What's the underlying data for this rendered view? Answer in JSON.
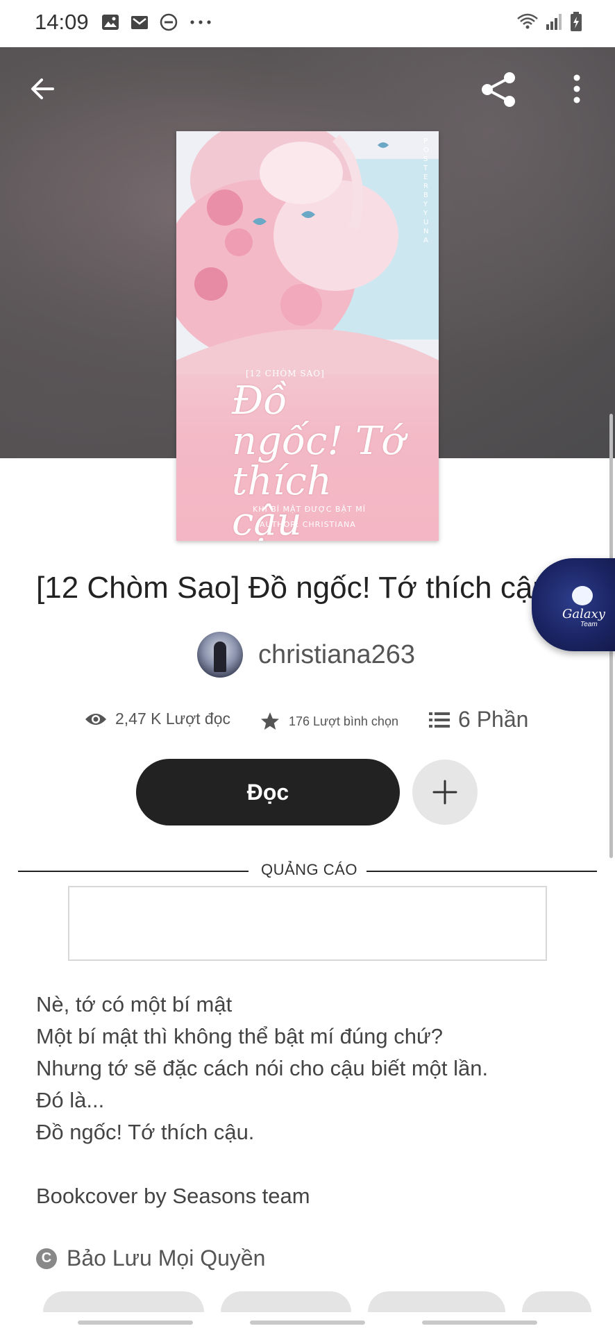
{
  "status_bar": {
    "time": "14:09",
    "icons_left": [
      "image-icon",
      "mail-icon",
      "do-not-disturb-icon",
      "more-dots-icon"
    ],
    "icons_right": [
      "wifi-icon",
      "signal-icon",
      "battery-charging-icon"
    ]
  },
  "header": {
    "back_icon": "arrow-left-icon",
    "share_icon": "share-icon",
    "more_icon": "more-vertical-icon"
  },
  "cover": {
    "series": "[12 CHÒM SAO]",
    "title": "Đồ ngốc! Tớ thích cậu",
    "subtitle": "KHI BÍ MẬT ĐƯỢC BẬT MÍ",
    "author": "AUTHOR: CHRISTIANA",
    "poster": "POSTER BY YUNA"
  },
  "story": {
    "title": "[12 Chòm Sao] Đồ ngốc! Tớ thích cậu"
  },
  "galaxy_bubble": {
    "label": "Galaxy",
    "sub": "Team"
  },
  "author": {
    "name": "christiana263"
  },
  "stats": {
    "reads": "2,47 K Lượt đọc",
    "votes": "176 Lượt bình chọn",
    "parts": "6 Phần"
  },
  "actions": {
    "read_label": "Đọc",
    "add_icon": "plus-icon"
  },
  "ad": {
    "label": "QUẢNG CÁO"
  },
  "description": {
    "lines": [
      "Nè, tớ có một bí mật",
      "Một bí mật thì không thể bật mí đúng chứ?",
      "Nhưng tớ sẽ đặc cách nói cho cậu biết một lần.",
      "Đó là...",
      "Đồ ngốc! Tớ thích cậu."
    ],
    "credit": "Bookcover by Seasons team"
  },
  "copyright": {
    "icon": "copyright-icon",
    "symbol": "C",
    "text": "Bảo Lưu Mọi Quyền"
  }
}
